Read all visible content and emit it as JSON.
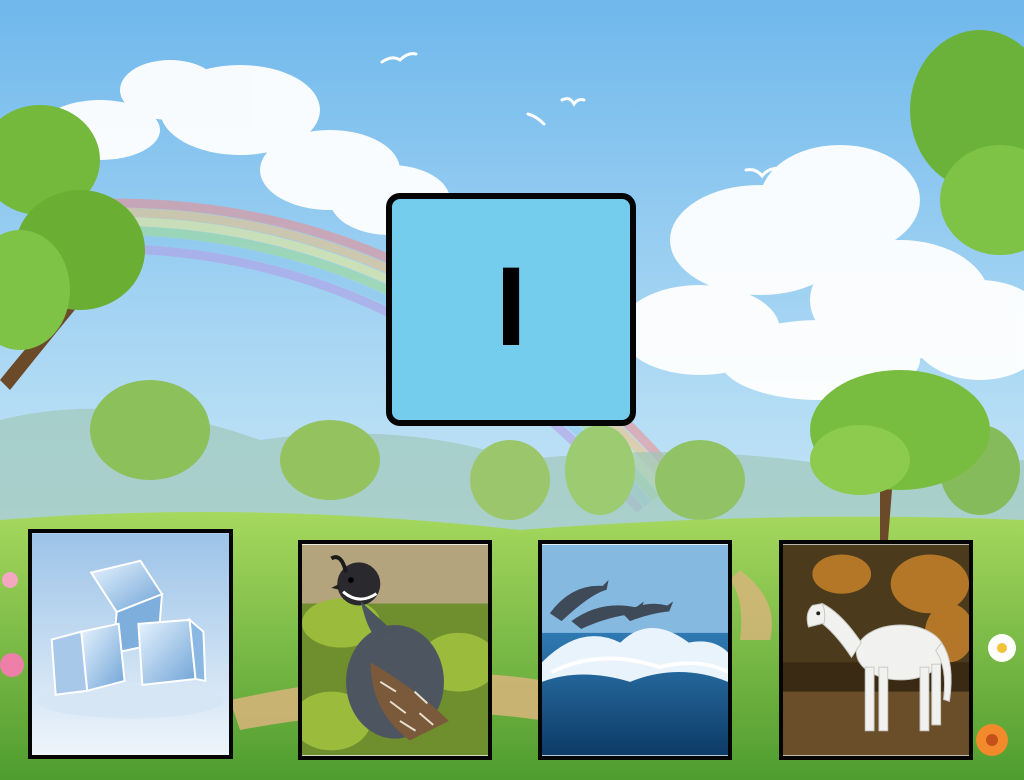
{
  "game": {
    "letter": "I",
    "choices": [
      {
        "id": "ice",
        "icon": "ice-cubes-image"
      },
      {
        "id": "quail",
        "icon": "quail-bird-image"
      },
      {
        "id": "dolphin",
        "icon": "dolphins-wave-image"
      },
      {
        "id": "horse",
        "icon": "white-horse-image"
      }
    ]
  },
  "colors": {
    "card_fill": "#74cdec",
    "card_border": "#050505",
    "sky": "#87c6ee",
    "grass": "#7cc24a"
  }
}
